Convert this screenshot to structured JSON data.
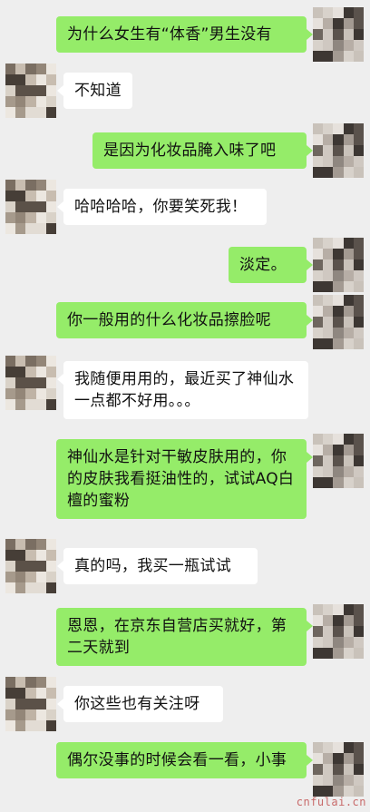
{
  "messages": [
    {
      "side": "right",
      "text": "为什么女生有“体香”男生没有"
    },
    {
      "side": "left",
      "text": "不知道"
    },
    {
      "side": "right",
      "text": "是因为化妆品腌入味了吧"
    },
    {
      "side": "left",
      "text": "哈哈哈哈，你要笑死我！"
    },
    {
      "side": "right",
      "text": "淡定。"
    },
    {
      "side": "right",
      "text": "你一般用的什么化妆品擦脸呢"
    },
    {
      "side": "left",
      "text": "我随便用用的，最近买了神仙水一点都不好用。。。"
    },
    {
      "side": "right",
      "text": "神仙水是针对干敏皮肤用的，你的皮肤我看挺油性的，试试AQ白檀的蜜粉"
    },
    {
      "side": "left",
      "text": "真的吗，我买一瓶试试"
    },
    {
      "side": "right",
      "text": "恩恩，在京东自营店买就好，第二天就到"
    },
    {
      "side": "left",
      "text": "你这些也有关注呀"
    },
    {
      "side": "right",
      "text": "偶尔没事的时候会看一看，小事"
    }
  ],
  "watermark": "cnfulai.cn",
  "colors": {
    "background": "#eeeeee",
    "sent_bubble": "#95ec69",
    "received_bubble": "#ffffff"
  }
}
